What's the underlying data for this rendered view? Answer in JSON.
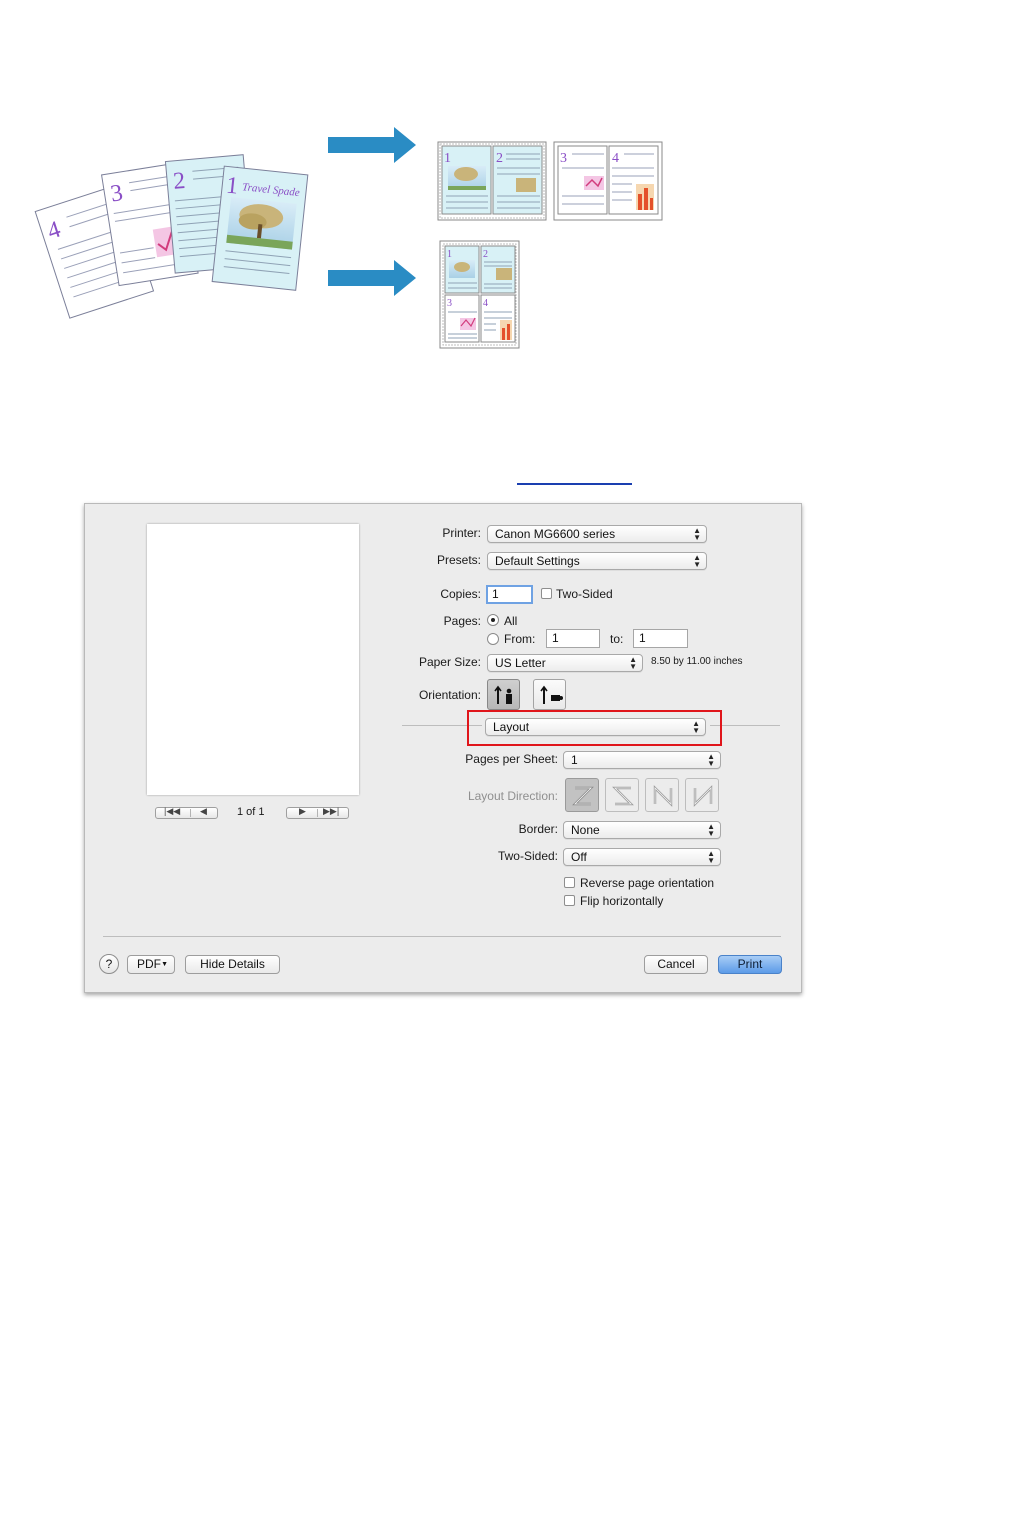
{
  "colors": {
    "arrow": "#2a8cc4",
    "highlight": "#e0151b",
    "print_button": "#5c9be8"
  },
  "illustration": {
    "source_page_numbers": [
      "4",
      "3",
      "2",
      "1"
    ],
    "source_title": "Travel Spade",
    "result_two_per_sheet": [
      [
        "1",
        "2"
      ],
      [
        "3",
        "4"
      ]
    ],
    "result_four_per_sheet": [
      "1",
      "2",
      "3",
      "4"
    ]
  },
  "dialog": {
    "printer": {
      "label": "Printer:",
      "value": "Canon MG6600 series"
    },
    "presets": {
      "label": "Presets:",
      "value": "Default Settings"
    },
    "copies": {
      "label": "Copies:",
      "value": "1",
      "two_sided_label": "Two-Sided"
    },
    "pages": {
      "label": "Pages:",
      "all_label": "All",
      "from_label": "From:",
      "from_value": "1",
      "to_label": "to:",
      "to_value": "1"
    },
    "paper_size": {
      "label": "Paper Size:",
      "value": "US Letter",
      "dimensions": "8.50 by 11.00 inches"
    },
    "orientation": {
      "label": "Orientation:"
    },
    "section_popup": {
      "value": "Layout"
    },
    "pages_per_sheet": {
      "label": "Pages per Sheet:",
      "value": "1"
    },
    "layout_direction": {
      "label": "Layout Direction:"
    },
    "border": {
      "label": "Border:",
      "value": "None"
    },
    "two_sided": {
      "label": "Two-Sided:",
      "value": "Off"
    },
    "reverse_orientation_label": "Reverse page orientation",
    "flip_horizontally_label": "Flip horizontally",
    "preview": {
      "page_indicator": "1 of 1"
    },
    "footer": {
      "help": "?",
      "pdf": "PDF",
      "hide_details": "Hide Details",
      "cancel": "Cancel",
      "print": "Print"
    }
  }
}
